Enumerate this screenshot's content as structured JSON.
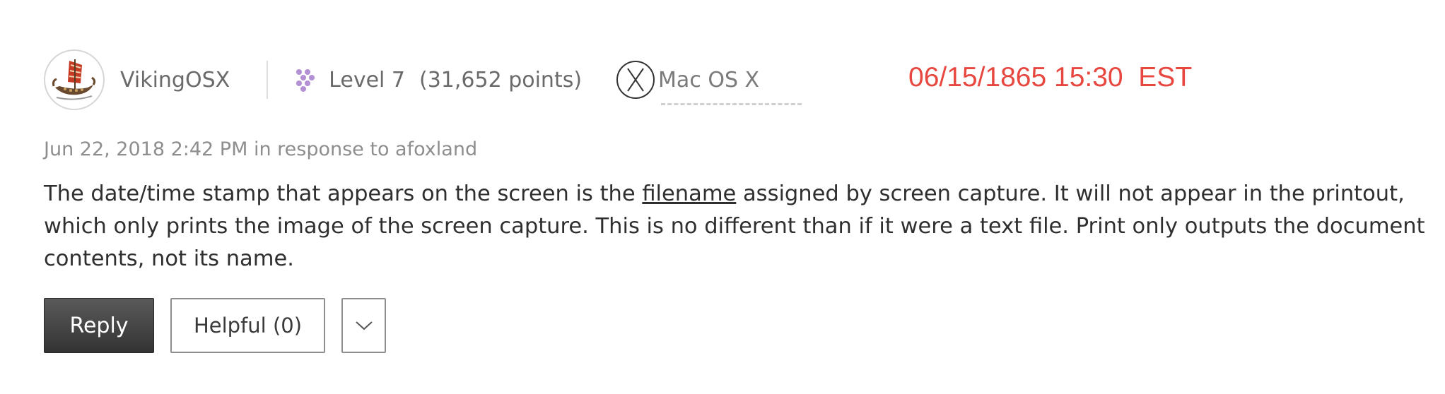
{
  "author": {
    "avatar_icon": "viking-ship-icon",
    "username": "VikingOSX",
    "level_icon": "level-dots-icon",
    "level_label": "Level 7",
    "points_label": "(31,652 points)",
    "os_icon": "mac-os-x-icon",
    "os_label": "Mac OS X"
  },
  "overlay": {
    "timestamp": "06/15/1865 15:30  EST",
    "color": "#e8473f"
  },
  "post": {
    "meta": "Jun 22, 2018 2:42 PM in response to afoxland",
    "body_part1": "The date/time stamp that appears on the screen is the ",
    "body_link": "filename",
    "body_part2": " assigned by screen capture. It will not appear in the printout, which only prints the image of the screen capture. This is no different than if it were a text file. Print only outputs the document contents, not its name."
  },
  "actions": {
    "reply_label": "Reply",
    "helpful_label": "Helpful (0)",
    "more_icon": "chevron-down-icon"
  }
}
